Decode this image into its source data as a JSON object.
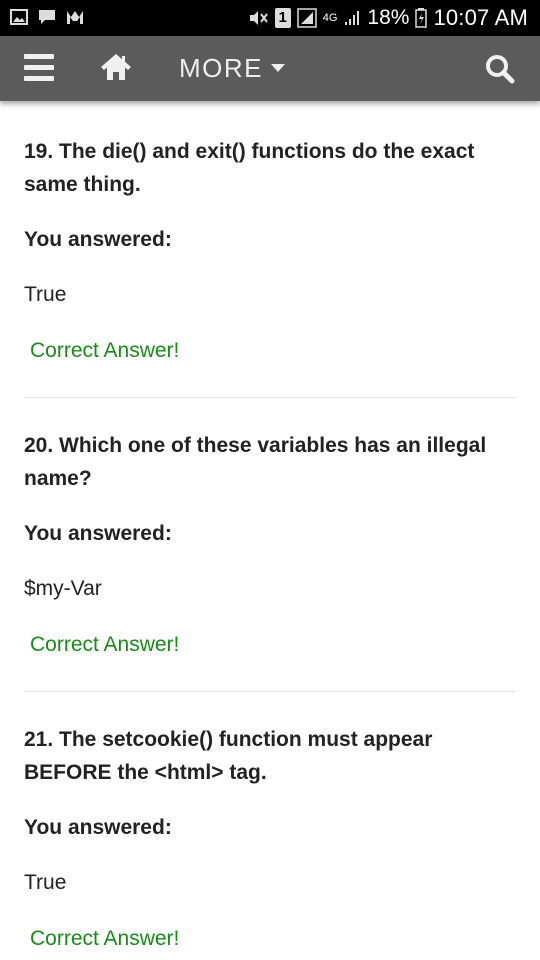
{
  "status_bar": {
    "battery_percent": "18%",
    "time": "10:07 AM",
    "network": "4G",
    "sim_slot": "1"
  },
  "nav": {
    "more_label": "MORE"
  },
  "questions": [
    {
      "question": "19. The die() and exit() functions do the exact same thing.",
      "answered_label": "You answered:",
      "answer": "True",
      "result": "Correct Answer!"
    },
    {
      "question": "20. Which one of these variables has an illegal name?",
      "answered_label": "You answered:",
      "answer": "$my-Var",
      "result": "Correct Answer!"
    },
    {
      "question": "21. The setcookie() function must appear BEFORE the <html> tag.",
      "answered_label": "You answered:",
      "answer": "True",
      "result": "Correct Answer!"
    }
  ],
  "colors": {
    "nav_bg": "#5b5b5b",
    "correct": "#1a8a1a",
    "status_bar_bg": "#000000"
  }
}
